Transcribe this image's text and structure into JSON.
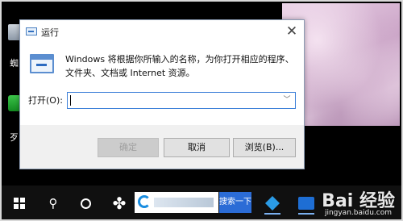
{
  "dialog": {
    "title": "运行",
    "close_glyph": "✕",
    "description": "Windows 将根据你所输入的名称，为你打开相应的程序、文件夹、文档或 Internet 资源。",
    "open_label": "打开(O):",
    "open_value": "",
    "dropdown_glyph": "﹀",
    "ok_label": "确定",
    "cancel_label": "取消",
    "browse_label": "浏览(B)..."
  },
  "desktop": {
    "icon1_label": "蜘",
    "icon2_label": "歹"
  },
  "taskbar": {
    "search_button_label": "搜索一下"
  },
  "watermark": {
    "brand": "Bai 经验",
    "site": "jingyan.baidu.com"
  },
  "icons": {
    "start": "windows-icon",
    "search": "search-icon",
    "task_view": "task-view-icon",
    "pinned_app": "pinwheel-icon"
  },
  "colors": {
    "accent": "#3c7fd8",
    "dialog_bg": "#f0f0f0",
    "taskbar_bg": "#101010"
  }
}
